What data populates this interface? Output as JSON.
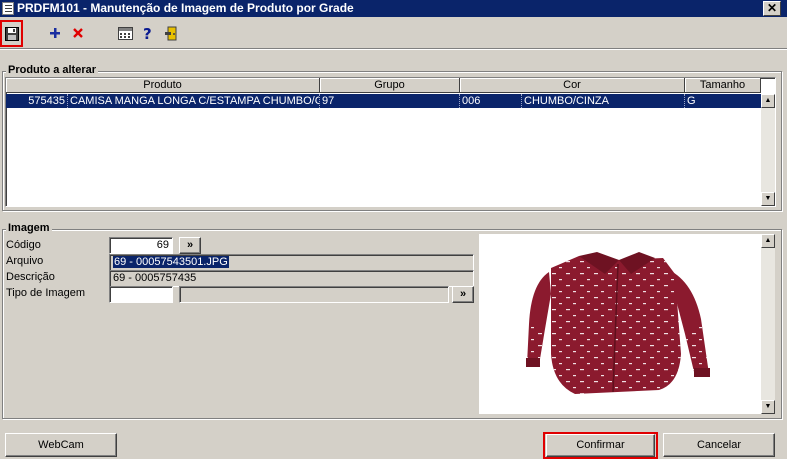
{
  "window": {
    "title": "PRDFM101 - Manutenção de Imagem de Produto por Grade",
    "close_label": "✕"
  },
  "toolbar": {
    "items": [
      {
        "name": "save-icon",
        "glyph": "💾"
      },
      {
        "name": "add-icon",
        "glyph": "+"
      },
      {
        "name": "delete-icon",
        "glyph": "✕"
      },
      {
        "name": "calculator-icon",
        "glyph": "▦"
      },
      {
        "name": "help-icon",
        "glyph": "?"
      },
      {
        "name": "exit-door-icon",
        "glyph": "▯"
      }
    ]
  },
  "produto_section": {
    "title": "Produto a alterar",
    "columns": [
      "Produto",
      "Grupo",
      "Cor",
      "Tamanho"
    ],
    "rows": [
      {
        "codigo": "575435",
        "produto": "CAMISA MANGA LONGA C/ESTAMPA CHUMBO/CIN",
        "grupo": "97",
        "cor_codigo": "006",
        "cor": "CHUMBO/CINZA",
        "tamanho": "G"
      }
    ]
  },
  "imagem_section": {
    "title": "Imagem",
    "codigo_label": "Código",
    "codigo_value": "69",
    "arquivo_label": "Arquivo",
    "arquivo_value": "69 - 00057543501.JPG",
    "descricao_label": "Descrição",
    "descricao_value": "69 - 0005757435",
    "tipo_label": "Tipo de Imagem",
    "tipo_value": "",
    "tipo_desc": "",
    "lookup_label": "»"
  },
  "buttons": {
    "webcam": "WebCam",
    "confirmar": "Confirmar",
    "cancelar": "Cancelar"
  },
  "colors": {
    "titlebar": "#0a246a",
    "selection": "#0a246a",
    "highlight_box": "#e00000",
    "shirt": "#8b1a2e"
  }
}
